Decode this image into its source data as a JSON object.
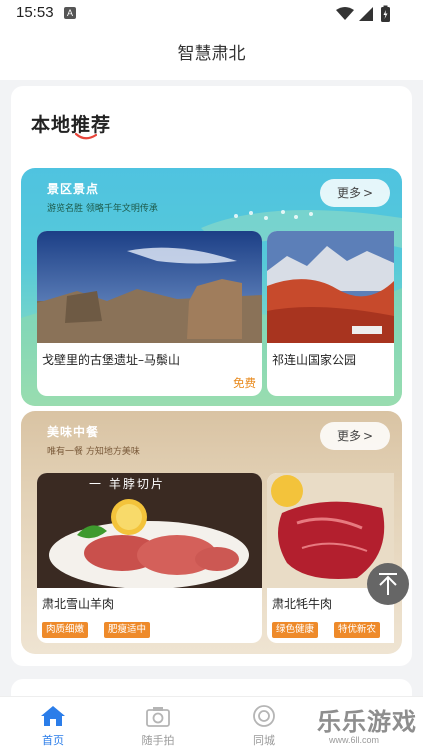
{
  "status_bar": {
    "time": "15:53",
    "notification_badge": "A"
  },
  "header": {
    "title": "智慧肃北"
  },
  "main": {
    "section_title": "本地推荐",
    "scenic": {
      "heading": "景区景点",
      "subheading": "游览名胜 领略千年文明传承",
      "more_label": "更多",
      "places": [
        {
          "name": "戈壁里的古堡遗址–马鬃山",
          "price": "免费"
        },
        {
          "name": "祁连山国家公园"
        }
      ]
    },
    "food": {
      "heading": "美味中餐",
      "subheading": "唯有一餐 方知地方美味",
      "more_label": "更多",
      "image_caption": "一 羊脖切片",
      "items": [
        {
          "name": "肃北雪山羊肉",
          "tags": [
            "肉质细嫩",
            "肥瘦适中"
          ]
        },
        {
          "name": "肃北牦牛肉",
          "tags": [
            "绿色健康",
            "特优新农"
          ]
        }
      ]
    }
  },
  "tab_bar": {
    "tabs": [
      {
        "label": "首页",
        "icon": "home-icon",
        "active": true
      },
      {
        "label": "随手拍",
        "icon": "camera-icon",
        "active": false
      },
      {
        "label": "同城",
        "icon": "nearby-icon",
        "active": false
      }
    ]
  },
  "watermark": {
    "text": "乐乐游戏",
    "url": "www.6ll.com"
  },
  "colors": {
    "accent": "#2b7de9",
    "price": "#e8881a",
    "tag_bg": "#ee8a2a"
  }
}
